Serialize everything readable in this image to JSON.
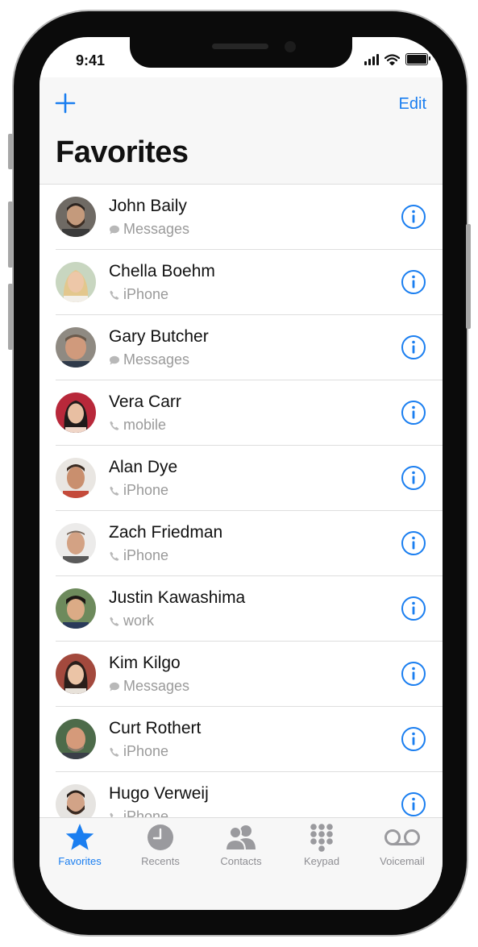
{
  "status_bar": {
    "time": "9:41"
  },
  "header": {
    "edit_label": "Edit",
    "title": "Favorites"
  },
  "favorites": [
    {
      "name": "John Baily",
      "type": "Messages",
      "icon": "message-bubble-icon"
    },
    {
      "name": "Chella Boehm",
      "type": "iPhone",
      "icon": "phone-icon"
    },
    {
      "name": "Gary Butcher",
      "type": "Messages",
      "icon": "message-bubble-icon"
    },
    {
      "name": "Vera Carr",
      "type": "mobile",
      "icon": "phone-icon"
    },
    {
      "name": "Alan Dye",
      "type": "iPhone",
      "icon": "phone-icon"
    },
    {
      "name": "Zach Friedman",
      "type": "iPhone",
      "icon": "phone-icon"
    },
    {
      "name": "Justin Kawashima",
      "type": "work",
      "icon": "phone-icon"
    },
    {
      "name": "Kim Kilgo",
      "type": "Messages",
      "icon": "message-bubble-icon"
    },
    {
      "name": "Curt Rothert",
      "type": "iPhone",
      "icon": "phone-icon"
    },
    {
      "name": "Hugo Verweij",
      "type": "iPhone",
      "icon": "phone-icon"
    }
  ],
  "tabs": [
    {
      "label": "Favorites",
      "icon": "star-icon",
      "active": true
    },
    {
      "label": "Recents",
      "icon": "clock-icon",
      "active": false
    },
    {
      "label": "Contacts",
      "icon": "contacts-icon",
      "active": false
    },
    {
      "label": "Keypad",
      "icon": "keypad-icon",
      "active": false
    },
    {
      "label": "Voicemail",
      "icon": "voicemail-icon",
      "active": false
    }
  ],
  "colors": {
    "accent": "#1a7ef0",
    "secondary_text": "#9a9a9a",
    "tab_inactive": "#8e8e93"
  }
}
